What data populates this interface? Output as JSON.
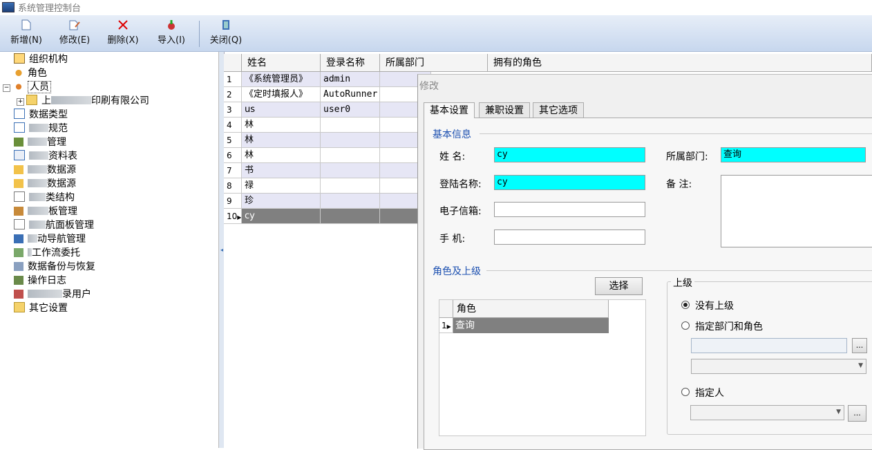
{
  "window": {
    "title": "系统管理控制台"
  },
  "toolbar": {
    "add": "新增(N)",
    "edit": "修改(E)",
    "delete": "删除(X)",
    "import": "导入(I)",
    "close": "关闭(Q)"
  },
  "tree": {
    "items": [
      {
        "label": "组织机构"
      },
      {
        "label": "角色"
      },
      {
        "label": "人员"
      },
      {
        "prefix": "上",
        "suffix": "印刷有限公司"
      },
      {
        "label": "数据类型"
      },
      {
        "suffix": "规范"
      },
      {
        "suffix": "管理"
      },
      {
        "suffix": "资料表"
      },
      {
        "suffix": "数据源"
      },
      {
        "suffix": "数据源"
      },
      {
        "suffix": "类结构"
      },
      {
        "suffix": "板管理"
      },
      {
        "suffix": "航面板管理"
      },
      {
        "suffix": "动导航管理"
      },
      {
        "suffix": "工作流委托"
      },
      {
        "suffix": "数据备份与恢复"
      },
      {
        "suffix": "操作日志"
      },
      {
        "suffix": "录用户"
      },
      {
        "label": "其它设置"
      }
    ]
  },
  "grid": {
    "columns": [
      "姓名",
      "登录名称",
      "所属部门",
      "拥有的角色"
    ],
    "rows": [
      {
        "num": "1",
        "name": "《系统管理员》",
        "login": "admin"
      },
      {
        "num": "2",
        "name": "《定时填报人》",
        "login": "AutoRunner"
      },
      {
        "num": "3",
        "name": "us",
        "login": "user0"
      },
      {
        "num": "4",
        "name": "林",
        "login": ""
      },
      {
        "num": "5",
        "name": "林",
        "login": ""
      },
      {
        "num": "6",
        "name": "林",
        "login": ""
      },
      {
        "num": "7",
        "name": "书",
        "login": ""
      },
      {
        "num": "8",
        "name": "禄",
        "login": ""
      },
      {
        "num": "9",
        "name": "珍",
        "login": ""
      },
      {
        "num": "10",
        "name": "cy",
        "login": ""
      }
    ]
  },
  "dialog": {
    "title": "修改",
    "tabs": [
      "基本设置",
      "兼职设置",
      "其它选项"
    ],
    "basic_info_title": "基本信息",
    "name_label": "姓    名:",
    "name_value": "cy",
    "login_label": "登陆名称:",
    "login_value": "cy",
    "email_label": "电子信箱:",
    "phone_label": "手    机:",
    "dept_label": "所属部门:",
    "dept_value": "查询",
    "remark_label": "备    注:",
    "role_section_title": "角色及上级",
    "select_button": "选择",
    "role_grid": {
      "header": "角色",
      "rows": [
        {
          "num": "1",
          "role": "查询"
        }
      ]
    },
    "superior": {
      "title": "上级",
      "options": [
        "没有上级",
        "指定部门和角色",
        "指定人"
      ],
      "selected": 0,
      "more_button": "..."
    }
  },
  "colors": {
    "cyan_field": "#00ffff",
    "row_alt": "#e6e6f5",
    "selected_row": "#808080",
    "section_blue": "#1b4fb0"
  }
}
